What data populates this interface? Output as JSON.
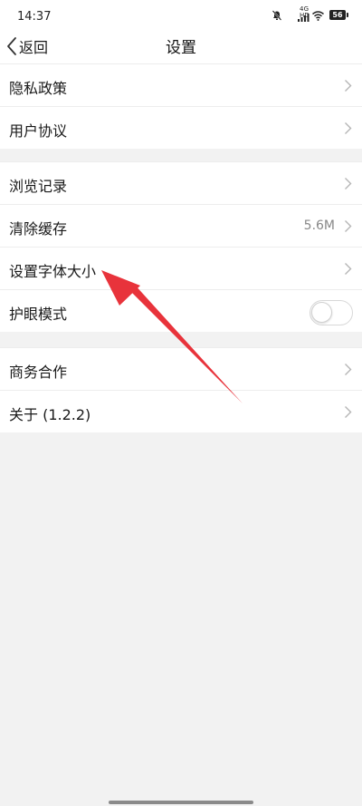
{
  "status_bar": {
    "time": "14:37",
    "network": "4G HD",
    "battery": "56",
    "icons": [
      "mute-icon",
      "signal-icon",
      "wifi-icon",
      "battery-icon"
    ]
  },
  "header": {
    "back_label": "返回",
    "title": "设置"
  },
  "groups": [
    {
      "items": [
        {
          "label": "隐私政策"
        },
        {
          "label": "用户协议"
        }
      ]
    },
    {
      "items": [
        {
          "label": "浏览记录"
        },
        {
          "label": "清除缓存",
          "value": "5.6M"
        },
        {
          "label": "设置字体大小"
        },
        {
          "label": "护眼模式",
          "toggle": false
        }
      ]
    },
    {
      "items": [
        {
          "label": "商务合作"
        },
        {
          "label": "关于 (1.2.2)"
        }
      ]
    }
  ],
  "colors": {
    "page_background": "#f2f2f2",
    "row_background": "#ffffff",
    "annotation_arrow": "#e8333b"
  }
}
